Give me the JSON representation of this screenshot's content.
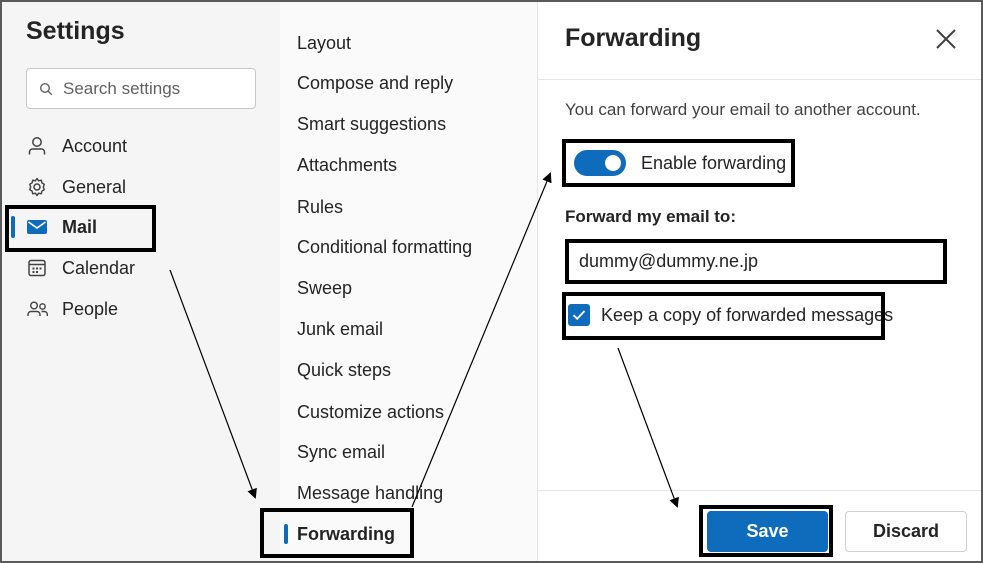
{
  "settings": {
    "title": "Settings",
    "search_placeholder": "Search settings",
    "nav": [
      {
        "label": "Account",
        "icon": "person-icon"
      },
      {
        "label": "General",
        "icon": "gear-icon"
      },
      {
        "label": "Mail",
        "icon": "mail-icon",
        "active": true
      },
      {
        "label": "Calendar",
        "icon": "calendar-icon"
      },
      {
        "label": "People",
        "icon": "people-icon"
      }
    ]
  },
  "mail_menu": {
    "items": [
      "Layout",
      "Compose and reply",
      "Smart suggestions",
      "Attachments",
      "Rules",
      "Conditional formatting",
      "Sweep",
      "Junk email",
      "Quick steps",
      "Customize actions",
      "Sync email",
      "Message handling",
      "Forwarding"
    ],
    "active": "Forwarding"
  },
  "forwarding": {
    "title": "Forwarding",
    "description": "You can forward your email to another account.",
    "enable_label": "Enable forwarding",
    "enabled": true,
    "forward_to_label": "Forward my email to:",
    "forward_to_value": "dummy@dummy.ne.jp",
    "keep_copy_label": "Keep a copy of forwarded messages",
    "keep_copy": true,
    "save_label": "Save",
    "discard_label": "Discard"
  },
  "colors": {
    "accent": "#0f6cbd",
    "annotation": "#000000"
  }
}
